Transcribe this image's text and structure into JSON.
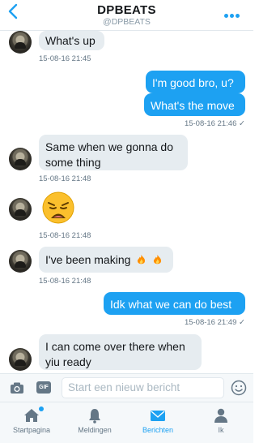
{
  "header": {
    "title": "DPBEATS",
    "handle": "@DPBEATS",
    "back_icon": "back-chevron-icon",
    "more_icon": "more-dots-icon"
  },
  "thread": {
    "m1": {
      "text": "What's up",
      "time": "15-08-16 21:45"
    },
    "m2": {
      "text": "I'm good bro, u?"
    },
    "m3": {
      "text": "What's the move",
      "time": "15-08-16 21:46"
    },
    "m4": {
      "text": "Same when we gonna do some thing",
      "time": "15-08-16 21:48"
    },
    "m5": {
      "emoji": "weary-face-icon",
      "time": "15-08-16 21:48"
    },
    "m6": {
      "text": "I've been making",
      "emoji": "fire-icon",
      "time": "15-08-16 21:48"
    },
    "m7": {
      "text": "Idk what we can do best",
      "time": "15-08-16 21:49"
    },
    "m8": {
      "text": "I can come over there when yiu ready"
    }
  },
  "composer": {
    "placeholder": "Start een nieuw bericht",
    "gif_label": "GIF"
  },
  "tabs": [
    {
      "label": "Startpagina",
      "icon": "home-icon"
    },
    {
      "label": "Meldingen",
      "icon": "bell-icon"
    },
    {
      "label": "Berichten",
      "icon": "mail-icon"
    },
    {
      "label": "Ik",
      "icon": "person-icon"
    }
  ],
  "colors": {
    "accent": "#1da1f2",
    "bubble_in": "#e6ecf0",
    "muted": "#657786"
  }
}
